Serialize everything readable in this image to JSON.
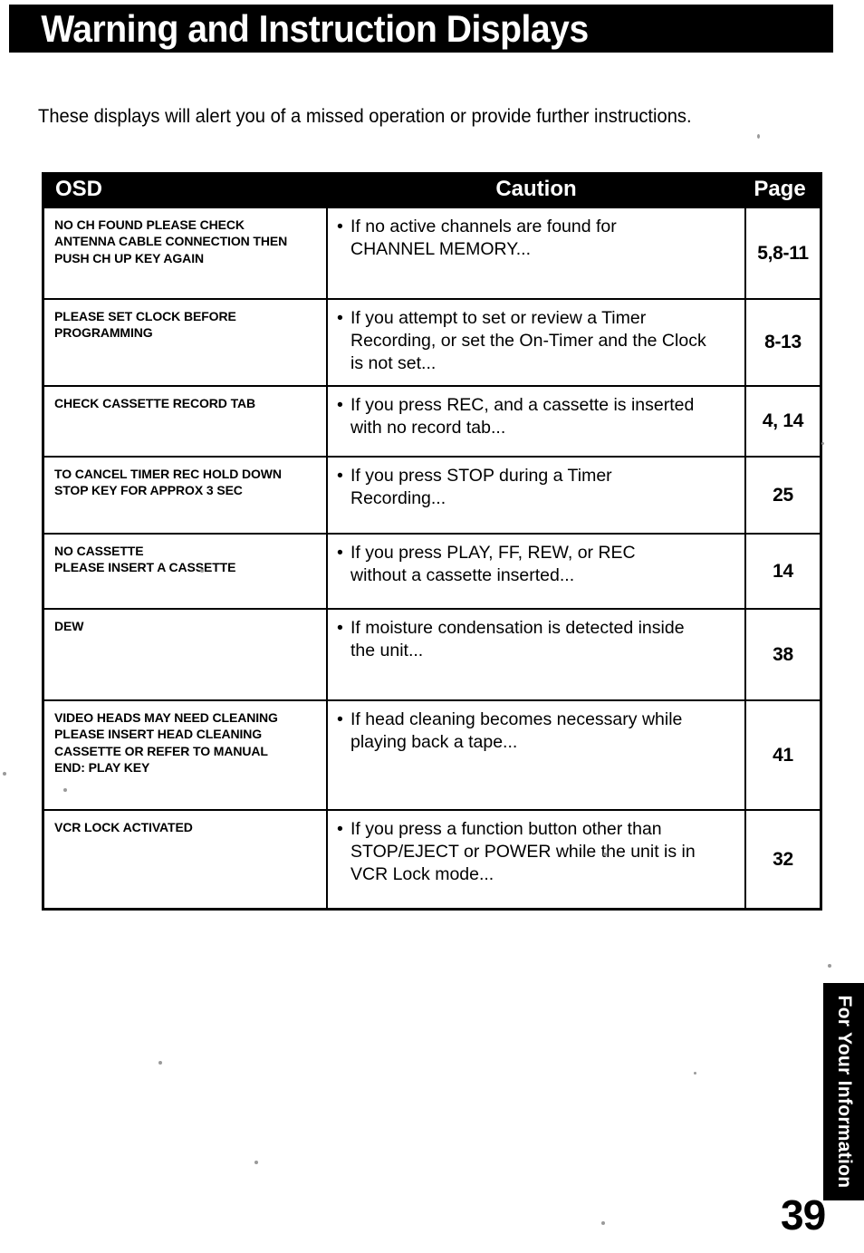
{
  "header": {
    "title": "Warning and Instruction Displays"
  },
  "intro": {
    "text": "These displays will alert you of a missed operation or provide further instructions."
  },
  "table": {
    "columns": {
      "osd": "OSD",
      "caution": "Caution",
      "page": "Page"
    },
    "rows": [
      {
        "osd_lines": [
          "NO CH FOUND PLEASE CHECK",
          "ANTENNA CABLE CONNECTION THEN",
          "PUSH CH UP KEY AGAIN"
        ],
        "caution_lines": [
          "If no active channels are found for",
          "CHANNEL MEMORY..."
        ],
        "page": "5,8-11"
      },
      {
        "osd_lines": [
          "PLEASE SET CLOCK BEFORE",
          "PROGRAMMING"
        ],
        "caution_lines": [
          "If you attempt to set or review a Timer",
          "Recording, or set the On-Timer and the Clock",
          "is not set..."
        ],
        "page": "8-13"
      },
      {
        "osd_lines": [
          "CHECK CASSETTE RECORD TAB"
        ],
        "caution_lines": [
          "If you press REC, and a cassette is inserted",
          "with no record tab..."
        ],
        "page": "4, 14"
      },
      {
        "osd_lines": [
          "TO CANCEL TIMER REC HOLD DOWN",
          "STOP KEY FOR APPROX 3 SEC"
        ],
        "caution_lines": [
          "If you press STOP during a Timer",
          "Recording..."
        ],
        "page": "25"
      },
      {
        "osd_lines": [
          "NO CASSETTE",
          "PLEASE INSERT A CASSETTE"
        ],
        "caution_lines": [
          "If you press PLAY, FF, REW, or REC",
          "without a cassette inserted..."
        ],
        "page": "14"
      },
      {
        "osd_lines": [
          "DEW"
        ],
        "caution_lines": [
          "If moisture condensation is detected inside",
          "the unit..."
        ],
        "page": "38"
      },
      {
        "osd_lines": [
          "VIDEO HEADS MAY NEED CLEANING",
          "PLEASE INSERT HEAD CLEANING",
          "CASSETTE OR REFER TO MANUAL",
          "END: PLAY KEY"
        ],
        "caution_lines": [
          "If head cleaning becomes necessary while",
          "playing back a tape..."
        ],
        "page": "41"
      },
      {
        "osd_lines": [
          "VCR LOCK ACTIVATED"
        ],
        "caution_lines": [
          "If you press a function button other than",
          "STOP/EJECT or POWER while the unit is in",
          "VCR Lock mode..."
        ],
        "page": "32"
      }
    ]
  },
  "side_tab": {
    "label": "For Your Information"
  },
  "footer": {
    "page_number": "39"
  },
  "symbols": {
    "bullet": "•"
  },
  "colors": {
    "ink": "#000000",
    "paper": "#ffffff"
  }
}
